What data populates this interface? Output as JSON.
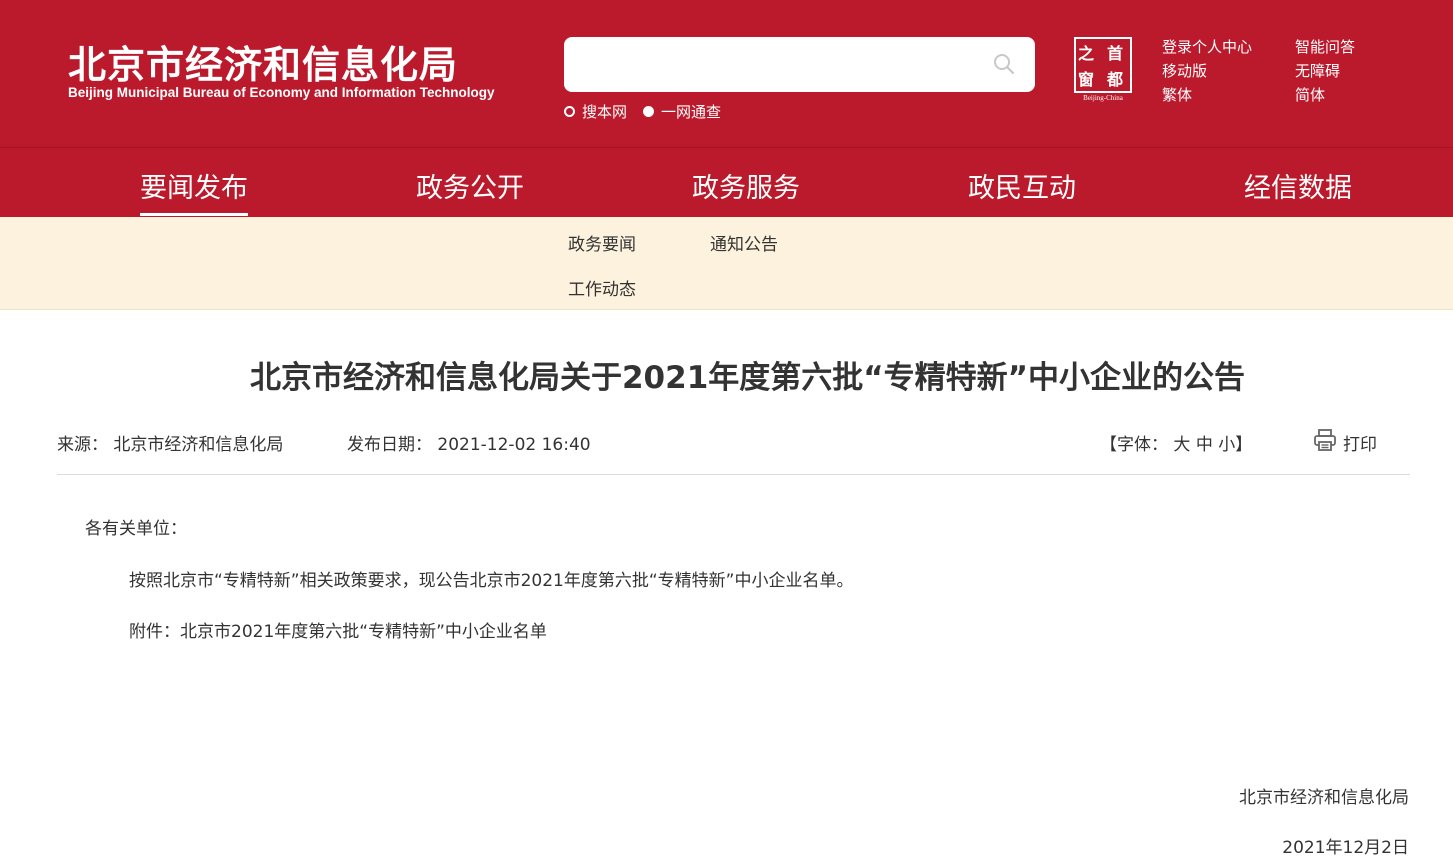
{
  "header": {
    "logo_cn": "北京市经济和信息化局",
    "logo_en": "Beijing Municipal Bureau of Economy and Information Technology",
    "search_placeholder": "",
    "search_options": [
      "搜本网",
      "一网通查"
    ],
    "capital_logo": {
      "chars": [
        "之",
        "首",
        "窗",
        "都"
      ],
      "subtitle": "Beijing-China"
    },
    "links_col1": [
      "登录个人中心",
      "移动版",
      "繁体"
    ],
    "links_col2": [
      "智能问答",
      "无障碍",
      "简体"
    ]
  },
  "nav": {
    "items": [
      "要闻发布",
      "政务公开",
      "政务服务",
      "政民互动",
      "经信数据"
    ],
    "active": "要闻发布"
  },
  "subnav": {
    "items": [
      "政务要闻",
      "通知公告",
      "工作动态"
    ]
  },
  "article": {
    "title": "北京市经济和信息化局关于2021年度第六批“专精特新”中小企业的公告",
    "source_label": "来源：",
    "source": "北京市经济和信息化局",
    "date_label": "发布日期：",
    "date": "2021-12-02 16:40",
    "font_size_label": "【字体：",
    "font_sizes": [
      "大",
      "中",
      "小"
    ],
    "font_size_close": "】",
    "print_label": "打印",
    "salutation": "各有关单位：",
    "paragraph1": "按照北京市“专精特新”相关政策要求，现公告北京市2021年度第六批“专精特新”中小企业名单。",
    "attachment": "附件：北京市2021年度第六批“专精特新”中小企业名单",
    "signature": "北京市经济和信息化局",
    "sign_date": "2021年12月2日"
  },
  "colors": {
    "brand_red": "#bb1a2c",
    "subnav_bg": "#fdf2dd"
  },
  "icons": [
    "search-icon",
    "print-icon"
  ]
}
